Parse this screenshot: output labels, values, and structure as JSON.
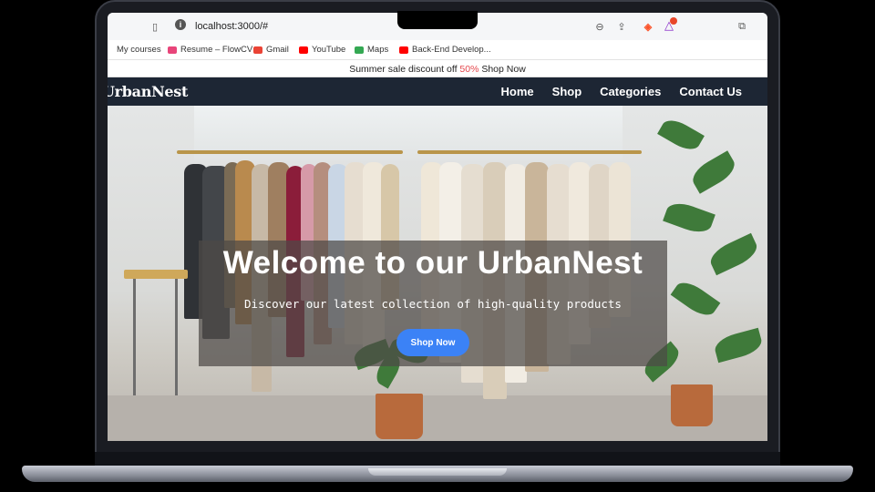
{
  "browser": {
    "url": "localhost:3000/#",
    "bookmarks": [
      {
        "label": "My courses",
        "color": "#888888"
      },
      {
        "label": "Resume – FlowCV",
        "color": "#e8457a"
      },
      {
        "label": "Gmail",
        "color": "#ea4335"
      },
      {
        "label": "YouTube",
        "color": "#ff0000"
      },
      {
        "label": "Maps",
        "color": "#34a853"
      },
      {
        "label": "Back-End Develop...",
        "color": "#ff0000"
      }
    ]
  },
  "promo": {
    "text_before": "Summer sale discount off ",
    "percent": "50%",
    "text_after": " Shop Now"
  },
  "nav": {
    "logo": "UrbanNest",
    "links": [
      "Home",
      "Shop",
      "Categories",
      "Contact Us"
    ]
  },
  "hero": {
    "title": "Welcome to our UrbanNest",
    "subtitle": "Discover our latest collection of high-quality products",
    "button": "Shop Now"
  },
  "colors": {
    "navbar": "#1d2634",
    "accent": "#3b82f6",
    "promo_highlight": "#e5484d"
  }
}
